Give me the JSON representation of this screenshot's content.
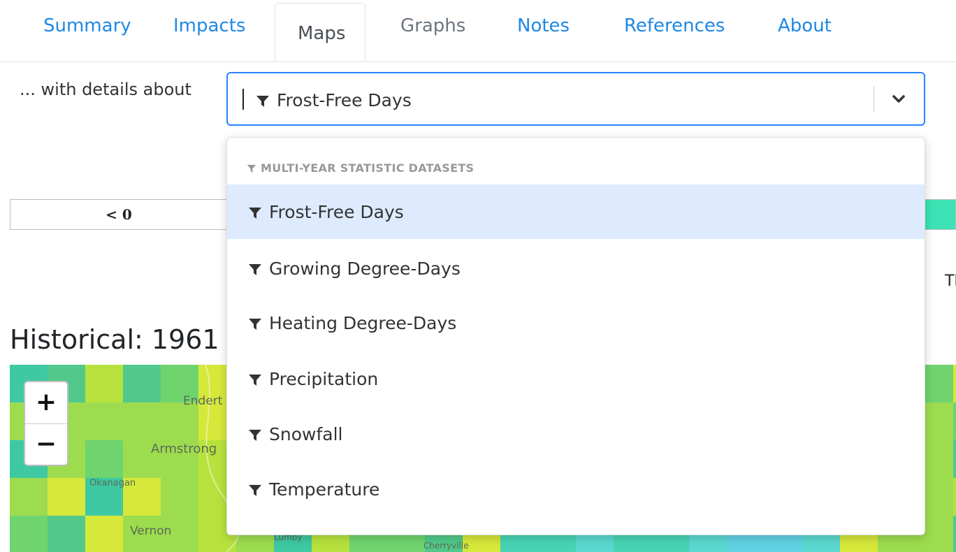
{
  "tabs": [
    {
      "label": "Summary",
      "state": "link"
    },
    {
      "label": "Impacts",
      "state": "link"
    },
    {
      "label": "Maps",
      "state": "active"
    },
    {
      "label": "Graphs",
      "state": "disabled"
    },
    {
      "label": "Notes",
      "state": "link"
    },
    {
      "label": "References",
      "state": "link"
    },
    {
      "label": "About",
      "state": "link"
    }
  ],
  "selector": {
    "label": "... with details about",
    "value": "Frost-Free Days"
  },
  "dropdown": {
    "group_header": "MULTI-YEAR STATISTIC DATASETS",
    "options": [
      {
        "label": "Frost-Free Days",
        "selected": true
      },
      {
        "label": "Growing Degree-Days",
        "selected": false
      },
      {
        "label": "Heating Degree-Days",
        "selected": false
      },
      {
        "label": "Precipitation",
        "selected": false
      },
      {
        "label": "Snowfall",
        "selected": false
      },
      {
        "label": "Temperature",
        "selected": false
      }
    ]
  },
  "legend": {
    "first_bin": "< 0",
    "cut_text": "Th"
  },
  "map": {
    "heading": "Historical: 1961",
    "zoom_in": "+",
    "zoom_out": "−",
    "place_labels": [
      "Endert",
      "Armstrong",
      "Okanagan",
      "Vernon",
      "Lumby",
      "Cherryville"
    ]
  },
  "colors": {
    "accent": "#1e88e5",
    "focus_border": "#2684ff",
    "selected_option": "#deebff",
    "legend_teal": "#3de3b4"
  },
  "icons": {
    "option_icon": "funnel-icon",
    "dropdown_icon": "chevron-down-icon"
  }
}
